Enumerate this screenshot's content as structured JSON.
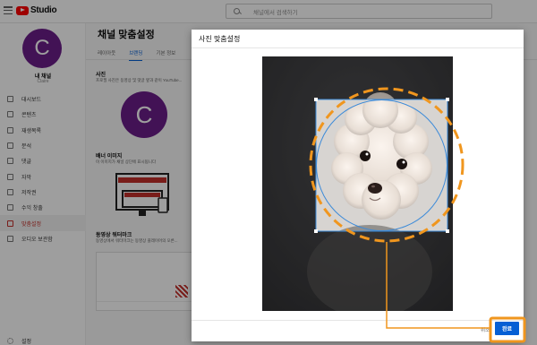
{
  "header": {
    "logo_text": "Studio",
    "search_placeholder": "채널에서 검색하기"
  },
  "sidebar": {
    "avatar_letter": "C",
    "channel_label": "내 채널",
    "channel_name": "Claire",
    "items": [
      {
        "label": "대시보드",
        "icon": "dashboard-icon"
      },
      {
        "label": "콘텐츠",
        "icon": "content-icon"
      },
      {
        "label": "재생목록",
        "icon": "playlist-icon"
      },
      {
        "label": "분석",
        "icon": "analytics-icon"
      },
      {
        "label": "댓글",
        "icon": "comments-icon"
      },
      {
        "label": "자막",
        "icon": "subtitles-icon"
      },
      {
        "label": "저작권",
        "icon": "copyright-icon"
      },
      {
        "label": "수익 창출",
        "icon": "monetization-icon"
      },
      {
        "label": "맞춤설정",
        "icon": "customization-icon",
        "active": true
      },
      {
        "label": "오디오 보관함",
        "icon": "audio-library-icon"
      }
    ],
    "settings_label": "설정"
  },
  "main": {
    "title": "채널 맞춤설정",
    "tabs": [
      {
        "label": "레이아웃"
      },
      {
        "label": "브랜딩",
        "active": true
      },
      {
        "label": "기본 정보"
      }
    ],
    "photo": {
      "title": "사진",
      "desc": "프로필 사진은 동영상 및 댓글 옆과 같이 YouTube...",
      "avatar_letter": "C"
    },
    "banner": {
      "title": "배너 이미지",
      "desc": "이 이미지가 채널 상단에 표시됩니다"
    },
    "watermark": {
      "title": "동영상 워터마크",
      "desc": "동영상에서 워터마크는 동영상 플레이어의 오른..."
    }
  },
  "dialog": {
    "title": "사진 맞춤설정",
    "cancel_label": "취소",
    "done_label": "완료"
  },
  "colors": {
    "brand_red": "#ff0000",
    "accent_blue": "#065fd4",
    "annotation_orange": "#f0961e",
    "avatar_purple": "#6b1e8a"
  }
}
